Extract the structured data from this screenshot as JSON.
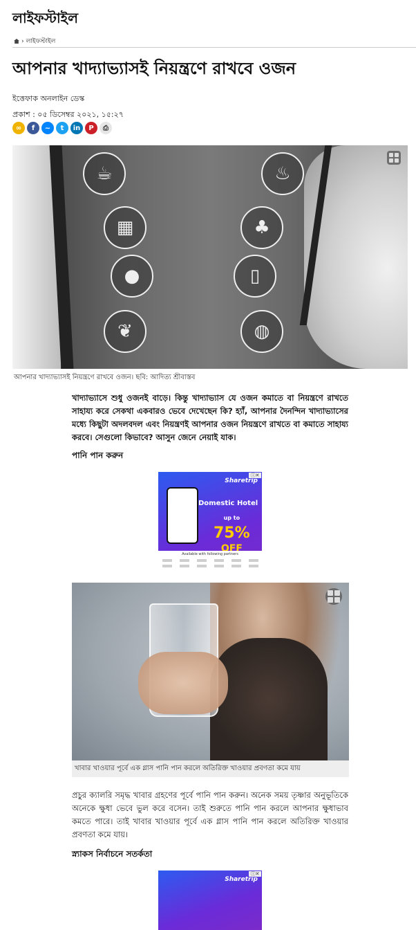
{
  "section": {
    "title": "লাইফস্টাইল"
  },
  "breadcrumb": {
    "current": "লাইফস্টাইল",
    "separator": "›"
  },
  "article": {
    "headline": "আপনার খাদ্যাভ্যাসই নিয়ন্ত্রণে রাখবে ওজন",
    "byline": "ইত্তেফাক অনলাইন ডেস্ক",
    "published": "প্রকাশ : ০৫ ডিসেম্বর ২০২১, ১৫:২৭",
    "share_icons": [
      "link-icon",
      "facebook-icon",
      "messenger-icon",
      "twitter-icon",
      "linkedin-icon",
      "pinterest-icon",
      "print-icon"
    ],
    "hero_caption": "আপনার খাদ্যাভ্যাসই নিয়ন্ত্রণে রাখবে ওজন। ছবি: আদিত্য শ্রীবাস্তব",
    "intro": "খাদ্যাভ্যাসে শুধু ওজনই বাড়ে। কিন্তু খাদ্যাভ্যাস যে ওজন কমাতে বা নিয়ন্ত্রণে রাখতে সাহায্য করে সেকথা একবারও ভেবে দেখেছেন কি? হ্যাঁ, আপনার দৈনন্দিন খাদ্যাভ্যাসের মধ্যে কিছুটা অদলবদল এবং নিয়ন্ত্রণই আপনার ওজন নিয়ন্ত্রণে রাখতে বা কমাতে সাহায্য করবে। সেগুলো কিভাবে? আসুন জেনে নেয়াই যাক।",
    "subhead_1": "পানি পান করুন",
    "water_caption": "খাবার খাওয়ার পূর্বে এক গ্লাস পানি পান করলে অতিরিক্ত খাওয়ার প্রবণতা কমে যায়",
    "paragraph_1": "প্রচুর ক্যালরি সমৃদ্ধ খাবার গ্রহণের পূর্বে পানি পান করুন। অনেক সময় তৃষ্ণার অনুভূতিকে অনেকে ক্ষুধা ভেবে ভুল করে বসেন। তাই শুরুতে পানি পান করলে আপনার ক্ষুধাভাব কমতে পারে। তাই খাবার খাওয়ার পূর্বে এক গ্লাস পানি পান করলে অতিরিক্ত খাওয়ার প্রবণতা কমে যায়।",
    "subhead_2": "স্ন্যাকস নির্বাচনে সতর্কতা"
  },
  "ad": {
    "logo": "Sharetrip",
    "badge": "ⓘ✕",
    "title": "Domestic Hotel",
    "upto": "up to",
    "discount": "75%",
    "off": "OFF",
    "partners_text": "Available with following partners"
  },
  "colors": {
    "facebook": "#3b5998",
    "messenger": "#0084ff",
    "twitter": "#1da1f2",
    "linkedin": "#0077b5",
    "pinterest": "#cb2027",
    "link": "#f0b400",
    "print": "#666666"
  }
}
